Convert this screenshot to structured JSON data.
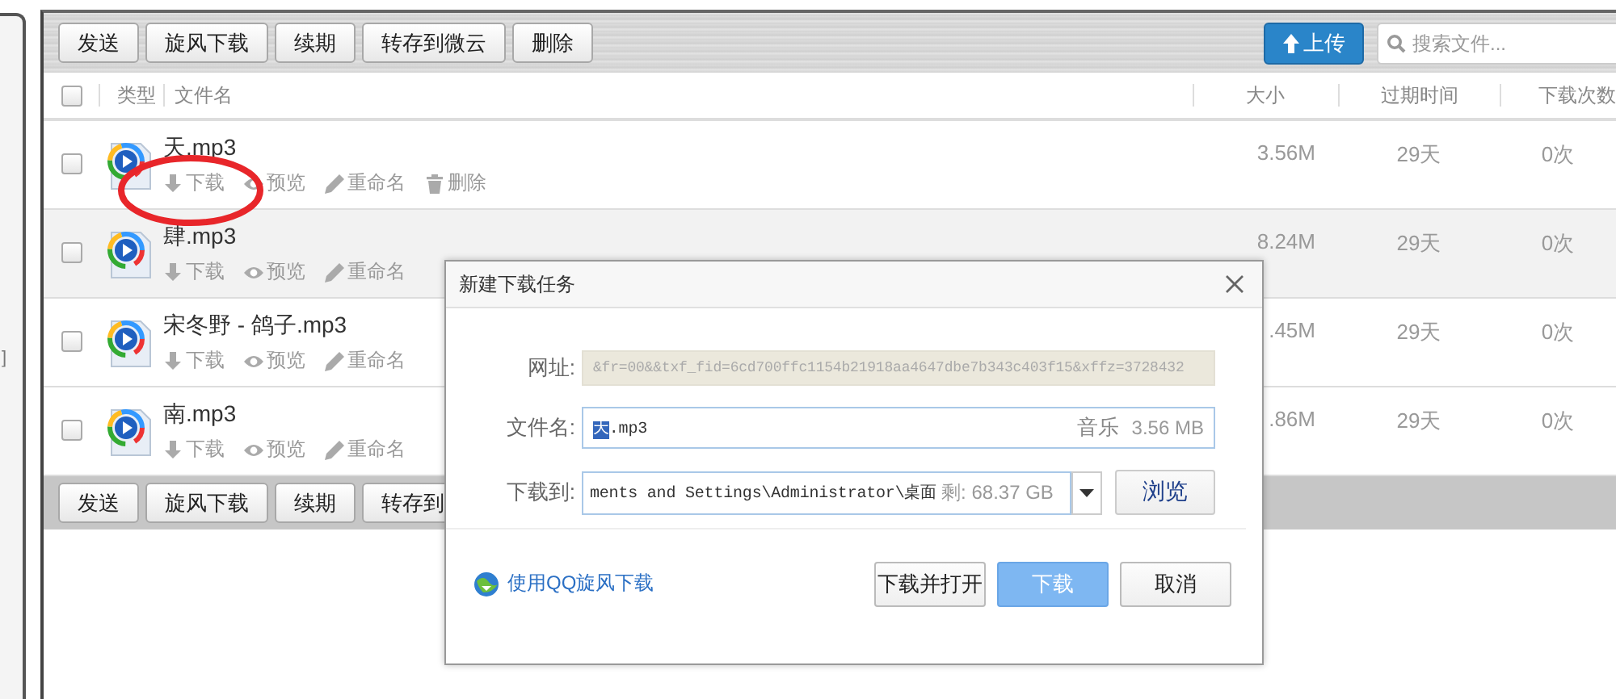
{
  "left_edge_text": "]",
  "toolbar": {
    "buttons": [
      "发送",
      "旋风下载",
      "续期",
      "转存到微云",
      "删除"
    ],
    "upload_button": "上传",
    "search": {
      "placeholder": "搜索文件..."
    }
  },
  "table": {
    "select_all_checked": false,
    "columns": [
      "类型",
      "文件名",
      "大小",
      "过期时间",
      "下载次数"
    ],
    "rows": [
      {
        "name": "天.mp3",
        "actions": [
          "下载",
          "预览",
          "重命名",
          "删除"
        ],
        "size": "3.56M",
        "expires": "29天",
        "downloads": "0次",
        "highlighted": false,
        "checked": false
      },
      {
        "name": "肆.mp3",
        "actions": [
          "下载",
          "预览",
          "重命名"
        ],
        "size": "8.24M",
        "expires": "29天",
        "downloads": "0次",
        "highlighted": true,
        "checked": false
      },
      {
        "name": "宋冬野 - 鸽子.mp3",
        "actions": [
          "下载",
          "预览",
          "重命名"
        ],
        "size": ".45M",
        "expires": "29天",
        "downloads": "0次",
        "highlighted": false,
        "checked": false
      },
      {
        "name": "南.mp3",
        "actions": [
          "下载",
          "预览",
          "重命名"
        ],
        "size": ".86M",
        "expires": "29天",
        "downloads": "0次",
        "highlighted": false,
        "checked": false
      }
    ]
  },
  "bottom_toolbar": {
    "buttons": [
      "发送",
      "旋风下载",
      "续期",
      "转存到"
    ]
  },
  "annotation": {
    "kind": "ellipse"
  },
  "dialog": {
    "title": "新建下载任务",
    "url": {
      "label": "网址:",
      "value": "&fr=00&&txf_fid=6cd700ffc1154b21918aa4647dbe7b343c403f15&xffz=3728432",
      "disabled": true
    },
    "filename": {
      "label": "文件名:",
      "value_parts": [
        {
          "text": "天",
          "selected": true
        },
        {
          "text": ".mp3",
          "selected": false
        }
      ],
      "type": "音乐",
      "size": "3.56 MB"
    },
    "save_to": {
      "label": "下载到:",
      "value": "ments and Settings\\Administrator\\桌面",
      "free": "剩: 68.37 GB",
      "browse_button": "浏览"
    },
    "qq_link": "使用QQ旋风下载",
    "buttons": [
      {
        "label": "下载并打开",
        "kind": "default"
      },
      {
        "label": "下载",
        "kind": "primary"
      },
      {
        "label": "取消",
        "kind": "default"
      }
    ]
  }
}
